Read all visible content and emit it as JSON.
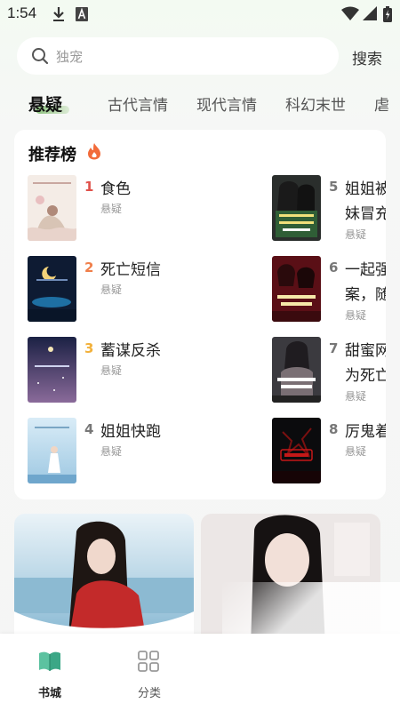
{
  "status": {
    "time": "1:54"
  },
  "search": {
    "placeholder": "独宠",
    "button": "搜索"
  },
  "tabs": [
    {
      "label": "悬疑"
    },
    {
      "label": "古代言情"
    },
    {
      "label": "现代言情"
    },
    {
      "label": "科幻末世"
    },
    {
      "label": "虐"
    }
  ],
  "ranking": {
    "title": "推荐榜",
    "items": [
      {
        "rank": "1",
        "title": "食色",
        "tag": "悬疑",
        "rank_color": "#e0524b"
      },
      {
        "rank": "2",
        "title": "死亡短信",
        "tag": "悬疑",
        "rank_color": "#f07f4a"
      },
      {
        "rank": "3",
        "title": "蓄谋反杀",
        "tag": "悬疑",
        "rank_color": "#f2b13b"
      },
      {
        "rank": "4",
        "title": "姐姐快跑",
        "tag": "悬疑",
        "rank_color": "#777777"
      },
      {
        "rank": "5",
        "title_l1": "姐姐被",
        "title_l2": "妹冒充",
        "tag": "悬疑",
        "rank_color": "#777777"
      },
      {
        "rank": "6",
        "title_l1": "一起强",
        "title_l2": "案，随",
        "tag": "悬疑",
        "rank_color": "#777777"
      },
      {
        "rank": "7",
        "title_l1": "甜蜜网",
        "title_l2": "为死亡",
        "tag": "悬疑",
        "rank_color": "#777777"
      },
      {
        "rank": "8",
        "title": "厉鬼着",
        "tag": "悬疑",
        "rank_color": "#777777"
      }
    ]
  },
  "bottom_nav": [
    {
      "label": "书城",
      "active": true
    },
    {
      "label": "分类",
      "active": false
    }
  ],
  "colors": {
    "accent": "#4caf8a",
    "active_tab_underline": "#6ab056"
  }
}
